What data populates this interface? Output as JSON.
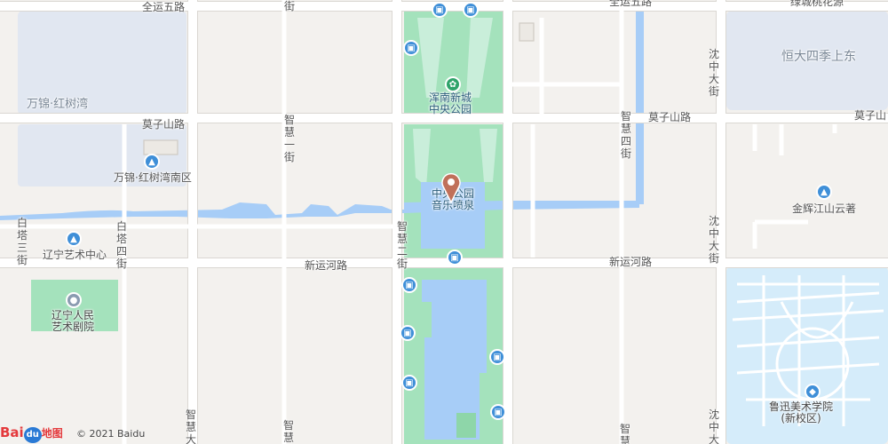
{
  "map": {
    "colors": {
      "background": "#f3f1ee",
      "road": "#ffffff",
      "road_edge": "#d8d6d2",
      "park": "#9fe0b8",
      "water": "#a7cdf7",
      "residential_blue": "#e2e8f2",
      "campus": "#d7eefb"
    },
    "streets": {
      "quanyun5": "全运五路",
      "quanyun_top": "全运五路",
      "mozishan_left": "莫子山路",
      "mozishan_mid": "莫子山路",
      "mozishan_right": "莫子山",
      "xinyunhe_left": "新运河路",
      "xinyunhe_right": "新运河路",
      "zhihui_yi": [
        "智",
        "慧",
        "一",
        "街"
      ],
      "zhihui_er": [
        "智",
        "慧",
        "二",
        "街"
      ],
      "zhihui_si": [
        "智",
        "慧",
        "四",
        "街"
      ],
      "zhihui_da_left": [
        "智",
        "慧",
        "大"
      ],
      "zhihui_da_right": [
        "智",
        "慧"
      ],
      "zhihui_bottom": [
        "智",
        "慧"
      ],
      "baita_san": [
        "白",
        "塔",
        "三",
        "街"
      ],
      "baita_si": [
        "白",
        "塔",
        "四",
        "街"
      ],
      "shenzhong_top": [
        "沈",
        "中",
        "大",
        "街"
      ],
      "shenzhong_mid": [
        "沈",
        "中",
        "大",
        "街"
      ],
      "shenzhong_bottom": [
        "沈",
        "中",
        "大"
      ],
      "top_small_mid": "全运五路",
      "top_right_partial": "绿城桃花源"
    },
    "areas": {
      "wanjin_hongshuwan": "万锦·红树湾",
      "hengda": "恒大四季上东"
    },
    "pois": {
      "wanjin_south": "万锦·红树湾南区",
      "liaoning_art_center": "辽宁艺术中心",
      "liaoning_theater_line1": "辽宁人民",
      "liaoning_theater_line2": "艺术剧院",
      "hunnan_park_line1": "浑南新城",
      "hunnan_park_line2": "中央公园",
      "fountain_line1": "中央公园",
      "fountain_line2": "音乐喷泉",
      "jinhui": "金辉江山云著",
      "luxun_line1": "鲁迅美术学院",
      "luxun_line2": "(新校区)"
    },
    "copyright": "© 2021 Baidu",
    "logo_text": "地图",
    "logo_brand": "Bai",
    "logo_du": "du"
  }
}
